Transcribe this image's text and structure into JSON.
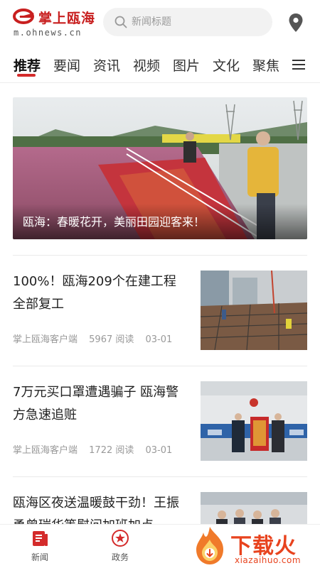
{
  "header": {
    "logo_title": "掌上瓯海",
    "logo_url": "m.ohnews.cn",
    "search_placeholder": "新闻标题"
  },
  "tabs": [
    {
      "label": "推荐",
      "active": true
    },
    {
      "label": "要闻"
    },
    {
      "label": "资讯"
    },
    {
      "label": "视频"
    },
    {
      "label": "图片"
    },
    {
      "label": "文化"
    },
    {
      "label": "聚焦"
    }
  ],
  "feature": {
    "caption": "瓯海：春暖花开，美丽田园迎客来！"
  },
  "news": [
    {
      "title": "100%！瓯海209个在建工程全部复工",
      "source": "掌上瓯海客户端",
      "reads": "5967 阅读",
      "date": "03-01"
    },
    {
      "title": "7万元买口罩遭遇骗子  瓯海警方急速追赃",
      "source": "掌上瓯海客户端",
      "reads": "1722 阅读",
      "date": "03-01"
    },
    {
      "title": "瓯海区夜送温暖鼓干劲！王振勇曾瑞华等慰问加班加点"
    }
  ],
  "bottom_nav": [
    {
      "label": "新闻",
      "icon": "news-icon"
    },
    {
      "label": "政务",
      "icon": "government-icon"
    }
  ],
  "watermark": {
    "text": "下载火",
    "sub": "xiazaihuo.com"
  },
  "colors": {
    "brand_red": "#c81f1f",
    "tab_underline": "#d42b2b",
    "watermark_orange": "#e8431e"
  }
}
